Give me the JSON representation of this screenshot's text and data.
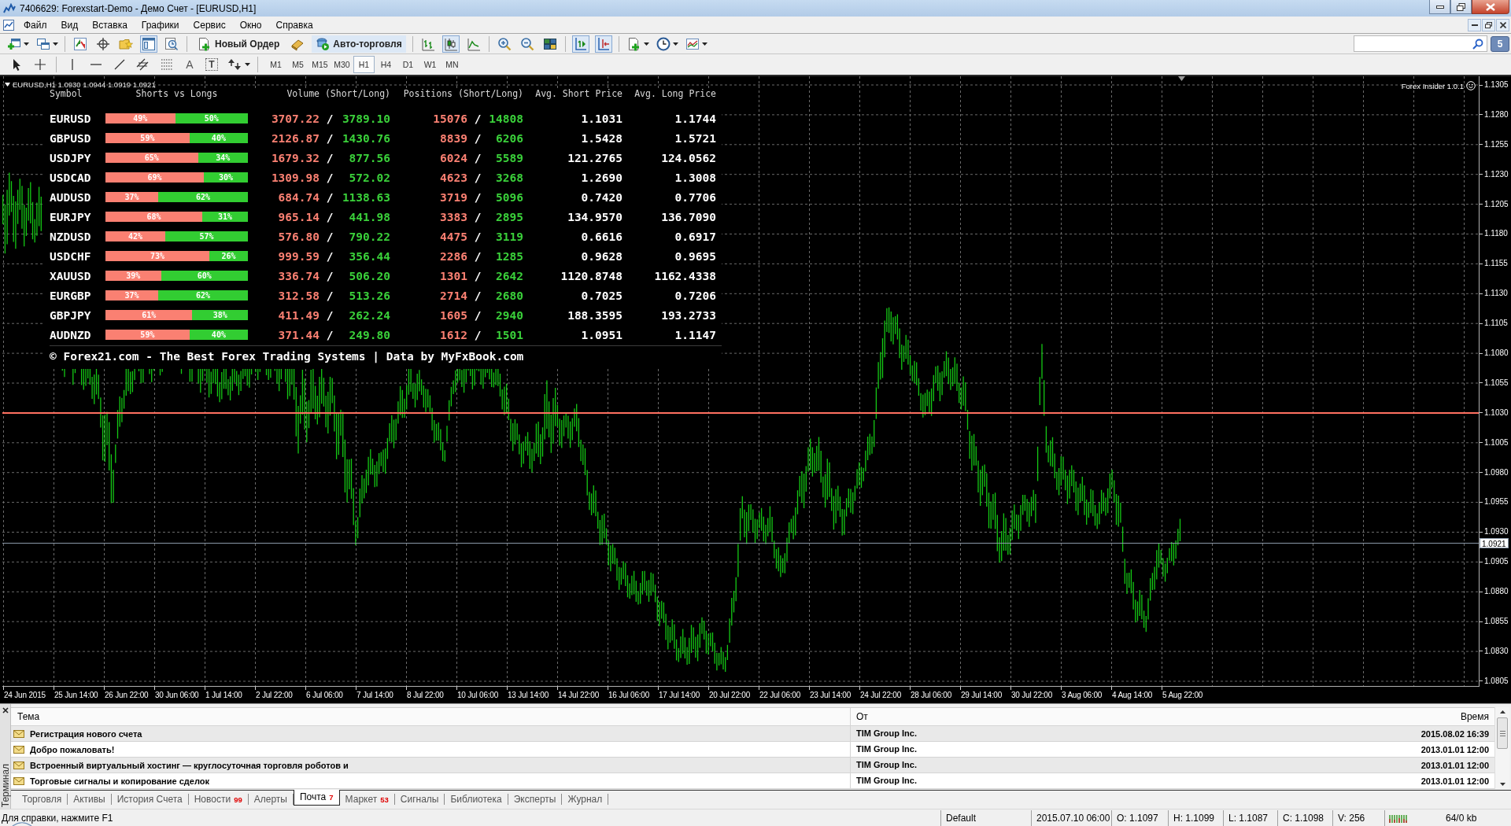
{
  "window": {
    "title": "7406629: Forexstart-Demo - Демо Счет - [EURUSD,H1]"
  },
  "menu": [
    "Файл",
    "Вид",
    "Вставка",
    "Графики",
    "Сервис",
    "Окно",
    "Справка"
  ],
  "toolbar": {
    "terminal_on": true,
    "new_order": "Новый Ордер",
    "auto_trading": {
      "label": "Авто-торговля",
      "on": true
    },
    "chart_types": [
      {
        "kind": "bars",
        "selected": false
      },
      {
        "kind": "candles",
        "selected": true
      },
      {
        "kind": "line",
        "selected": false
      }
    ],
    "chart_shift_on": true,
    "autoscroll_on": true,
    "messages_count": "5"
  },
  "drawing_toolbar": {
    "text_tool": "A",
    "text_label_tool": "T",
    "timeframes": [
      {
        "label": "M1",
        "selected": false
      },
      {
        "label": "M5",
        "selected": false
      },
      {
        "label": "M15",
        "selected": false
      },
      {
        "label": "M30",
        "selected": false
      },
      {
        "label": "H1",
        "selected": true
      },
      {
        "label": "H4",
        "selected": false
      },
      {
        "label": "D1",
        "selected": false
      },
      {
        "label": "W1",
        "selected": false
      },
      {
        "label": "MN",
        "selected": false
      }
    ]
  },
  "chart": {
    "header": "EURUSD,H1 1.0930 1.0944 1.0919 1.0921",
    "indicator": "Forex Insider 1.0.1",
    "price_labels": [
      "1.1305",
      "1.1280",
      "1.1255",
      "1.1230",
      "1.1205",
      "1.1180",
      "1.1155",
      "1.1130",
      "1.1105",
      "1.1080",
      "1.1055",
      "1.1030",
      "1.1005",
      "1.0980",
      "1.0955",
      "1.0930",
      "1.0905",
      "1.0880",
      "1.0855",
      "1.0830",
      "1.0805"
    ],
    "current_price": "1.0921",
    "time_labels": [
      "24 Jun 2015",
      "25 Jun 14:00",
      "26 Jun 22:00",
      "30 Jun 06:00",
      "1 Jul 14:00",
      "2 Jul 22:00",
      "6 Jul 06:00",
      "7 Jul 14:00",
      "8 Jul 22:00",
      "10 Jul 06:00",
      "13 Jul 14:00",
      "14 Jul 22:00",
      "16 Jul 06:00",
      "17 Jul 14:00",
      "20 Jul 22:00",
      "22 Jul 06:00",
      "23 Jul 14:00",
      "24 Jul 22:00",
      "28 Jul 06:00",
      "29 Jul 14:00",
      "30 Jul 22:00",
      "3 Aug 06:00",
      "4 Aug 14:00",
      "5 Aug 22:00"
    ]
  },
  "insider_table": {
    "columns": [
      "Symbol",
      "Shorts vs Longs",
      "Volume (Short/Long)",
      "Positions (Short/Long)",
      "Avg. Short Price",
      "Avg. Long Price"
    ],
    "rows": [
      {
        "symbol": "EURUSD",
        "short_pct": "49%",
        "long_pct": "50%",
        "level": 0.49,
        "short_volume": "3707.22",
        "volume_sep": "/",
        "long_volume": "3789.10",
        "short_positions": "15076",
        "positions_sep": "/",
        "long_positions": "14808",
        "avg_short": "1.1031",
        "avg_long": "1.1744"
      },
      {
        "symbol": "GBPUSD",
        "short_pct": "59%",
        "long_pct": "40%",
        "level": 0.59,
        "short_volume": "2126.87",
        "volume_sep": "/",
        "long_volume": "1430.76",
        "short_positions": "8839",
        "positions_sep": "/",
        "long_positions": "6206",
        "avg_short": "1.5428",
        "avg_long": "1.5721"
      },
      {
        "symbol": "USDJPY",
        "short_pct": "65%",
        "long_pct": "34%",
        "level": 0.65,
        "short_volume": "1679.32",
        "volume_sep": "/",
        "long_volume": "877.56",
        "short_positions": "6024",
        "positions_sep": "/",
        "long_positions": "5589",
        "avg_short": "121.2765",
        "avg_long": "124.0562"
      },
      {
        "symbol": "USDCAD",
        "short_pct": "69%",
        "long_pct": "30%",
        "level": 0.69,
        "short_volume": "1309.98",
        "volume_sep": "/",
        "long_volume": "572.02",
        "short_positions": "4623",
        "positions_sep": "/",
        "long_positions": "3268",
        "avg_short": "1.2690",
        "avg_long": "1.3008"
      },
      {
        "symbol": "AUDUSD",
        "short_pct": "37%",
        "long_pct": "62%",
        "level": 0.37,
        "short_volume": "684.74",
        "volume_sep": "/",
        "long_volume": "1138.63",
        "short_positions": "3719",
        "positions_sep": "/",
        "long_positions": "5096",
        "avg_short": "0.7420",
        "avg_long": "0.7706"
      },
      {
        "symbol": "EURJPY",
        "short_pct": "68%",
        "long_pct": "31%",
        "level": 0.68,
        "short_volume": "965.14",
        "volume_sep": "/",
        "long_volume": "441.98",
        "short_positions": "3383",
        "positions_sep": "/",
        "long_positions": "2895",
        "avg_short": "134.9570",
        "avg_long": "136.7090"
      },
      {
        "symbol": "NZDUSD",
        "short_pct": "42%",
        "long_pct": "57%",
        "level": 0.42,
        "short_volume": "576.80",
        "volume_sep": "/",
        "long_volume": "790.22",
        "short_positions": "4475",
        "positions_sep": "/",
        "long_positions": "3119",
        "avg_short": "0.6616",
        "avg_long": "0.6917"
      },
      {
        "symbol": "USDCHF",
        "short_pct": "73%",
        "long_pct": "26%",
        "level": 0.73,
        "short_volume": "999.59",
        "volume_sep": "/",
        "long_volume": "356.44",
        "short_positions": "2286",
        "positions_sep": "/",
        "long_positions": "1285",
        "avg_short": "0.9628",
        "avg_long": "0.9695"
      },
      {
        "symbol": "XAUUSD",
        "short_pct": "39%",
        "long_pct": "60%",
        "level": 0.39,
        "short_volume": "336.74",
        "volume_sep": "/",
        "long_volume": "506.20",
        "short_positions": "1301",
        "positions_sep": "/",
        "long_positions": "2642",
        "avg_short": "1120.8748",
        "avg_long": "1162.4338"
      },
      {
        "symbol": "EURGBP",
        "short_pct": "37%",
        "long_pct": "62%",
        "level": 0.37,
        "short_volume": "312.58",
        "volume_sep": "/",
        "long_volume": "513.26",
        "short_positions": "2714",
        "positions_sep": "/",
        "long_positions": "2680",
        "avg_short": "0.7025",
        "avg_long": "0.7206"
      },
      {
        "symbol": "GBPJPY",
        "short_pct": "61%",
        "long_pct": "38%",
        "level": 0.61,
        "short_volume": "411.49",
        "volume_sep": "/",
        "long_volume": "262.24",
        "short_positions": "1605",
        "positions_sep": "/",
        "long_positions": "2940",
        "avg_short": "188.3595",
        "avg_long": "193.2733"
      },
      {
        "symbol": "AUDNZD",
        "short_pct": "59%",
        "long_pct": "40%",
        "level": 0.59,
        "short_volume": "371.44",
        "volume_sep": "/",
        "long_volume": "249.80",
        "short_positions": "1612",
        "positions_sep": "/",
        "long_positions": "1501",
        "avg_short": "1.0951",
        "avg_long": "1.1147"
      }
    ],
    "footer": "© Forex21.com - The Best Forex Trading Systems | Data by MyFxBook.com"
  },
  "terminal": {
    "title": "Терминал",
    "columns": [
      "Тема",
      "От",
      "Время"
    ],
    "rows": [
      {
        "subject": "Регистрация нового счета",
        "from": "TIM Group Inc.",
        "time": "2015.08.02 16:39"
      },
      {
        "subject": "Добро пожаловать!",
        "from": "TIM Group Inc.",
        "time": "2013.01.01 12:00"
      },
      {
        "subject": "Встроенный виртуальный хостинг — круглосуточная торговля роботов и",
        "from": "TIM Group Inc.",
        "time": "2013.01.01 12:00"
      },
      {
        "subject": "Торговые сигналы и копирование сделок",
        "from": "TIM Group Inc.",
        "time": "2013.01.01 12:00"
      }
    ],
    "tabs": [
      {
        "label": "Торговля",
        "selected": false
      },
      {
        "label": "Активы",
        "selected": false
      },
      {
        "label": "История Счета",
        "selected": false
      },
      {
        "label": "Новости",
        "count": "99",
        "selected": false
      },
      {
        "label": "Алерты",
        "selected": false
      },
      {
        "label": "Почта",
        "count": "7",
        "selected": true
      },
      {
        "label": "Маркет",
        "count": "53",
        "selected": false
      },
      {
        "label": "Сигналы",
        "selected": false
      },
      {
        "label": "Библиотека",
        "selected": false
      },
      {
        "label": "Эксперты",
        "selected": false
      },
      {
        "label": "Журнал",
        "selected": false
      }
    ]
  },
  "status_bar": {
    "help": "Для справки, нажмите F1",
    "profile": "Default",
    "datetime": "2015.07.10 06:00",
    "open": "O: 1.1097",
    "high": "H: 1.1099",
    "low": "L: 1.1087",
    "close": "C: 1.1098",
    "volume": "V: 256",
    "traffic": "64/0 kb"
  }
}
